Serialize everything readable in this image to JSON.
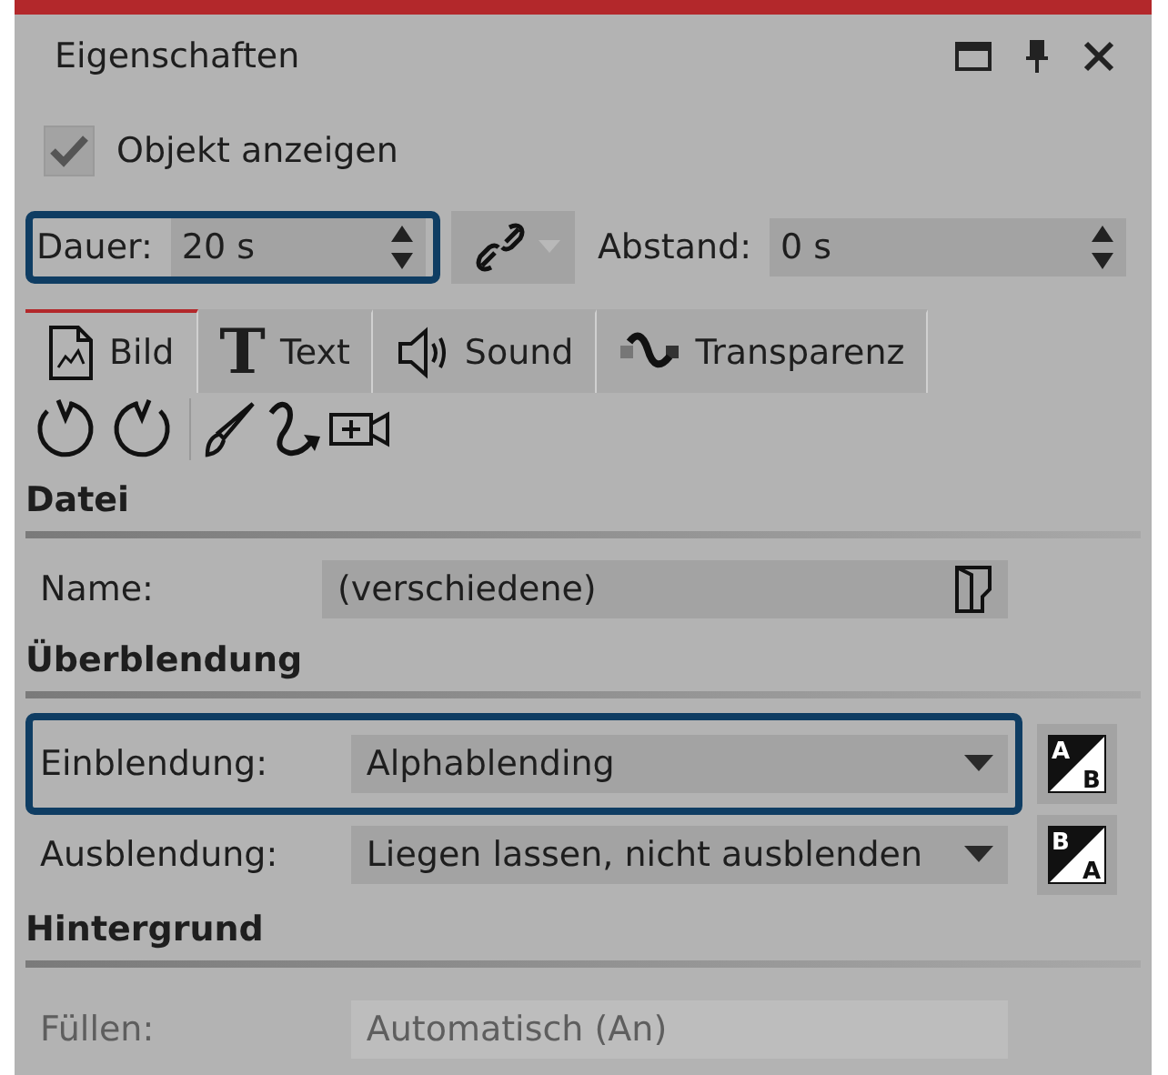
{
  "window": {
    "title": "Eigenschaften"
  },
  "show_object": {
    "label": "Objekt anzeigen",
    "checked": true
  },
  "duration": {
    "label": "Dauer:",
    "value": "20 s",
    "highlighted": true
  },
  "spacing": {
    "label": "Abstand:",
    "value": "0 s"
  },
  "tabs": [
    {
      "kind": "image",
      "label": "Bild",
      "selected": true
    },
    {
      "kind": "text",
      "glyph": "T",
      "label": "Text",
      "selected": false
    },
    {
      "kind": "sound",
      "label": "Sound",
      "selected": false
    },
    {
      "kind": "transparency",
      "label": "Transparenz",
      "selected": false
    }
  ],
  "sections": [
    {
      "title": "Datei",
      "fields": [
        {
          "kind": "file",
          "label": "Name:",
          "value": "(verschiedene)",
          "highlighted": false
        }
      ]
    },
    {
      "title": "Überblendung",
      "fields": [
        {
          "kind": "dropdown",
          "label": "Einblendung:",
          "value": "Alphablending",
          "highlighted": true,
          "swap": {
            "top": "A",
            "bottom": "B"
          }
        },
        {
          "kind": "dropdown",
          "label": "Ausblendung:",
          "value": "Liegen lassen, nicht ausblenden",
          "highlighted": false,
          "swap": {
            "top": "B",
            "bottom": "A"
          }
        }
      ]
    },
    {
      "title": "Hintergrund",
      "fields": [
        {
          "kind": "faded",
          "label": "Füllen:",
          "value": "Automatisch (An)",
          "highlighted": false
        }
      ]
    }
  ]
}
